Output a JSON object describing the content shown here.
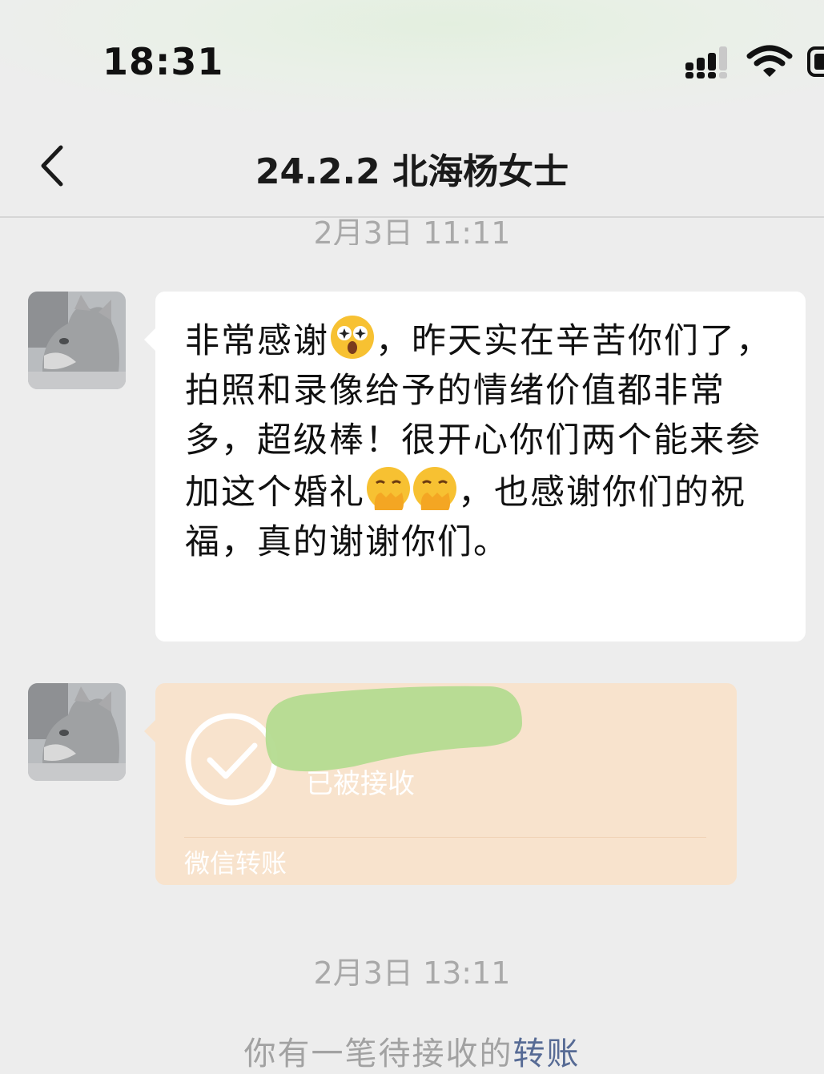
{
  "status_bar": {
    "time": "18:31"
  },
  "nav": {
    "title": "24.2.2 北海杨女士"
  },
  "messages": {
    "ts1": "2月3日 11:11",
    "text_parts": [
      "非常感谢",
      "，昨天实在辛苦你们了，拍照和录像给予的情绪价值都非常多，超级棒！很开心你们两个能来参加这个婚礼",
      "",
      "，也感谢你们的祝福，真的谢谢你们。"
    ],
    "emoji_names": [
      "starry-eyes-emoji",
      "hand-over-mouth-emoji",
      "hand-over-mouth-emoji"
    ]
  },
  "transfer": {
    "status": "已被接收",
    "footer": "微信转账"
  },
  "ts2": "2月3日 13:11",
  "system": {
    "prefix": "你有一笔待接收的",
    "link": "转账"
  },
  "colors": {
    "background": "#ededed",
    "bubble": "#ffffff",
    "transfer": "#f8e3cd",
    "link": "#576b95"
  }
}
